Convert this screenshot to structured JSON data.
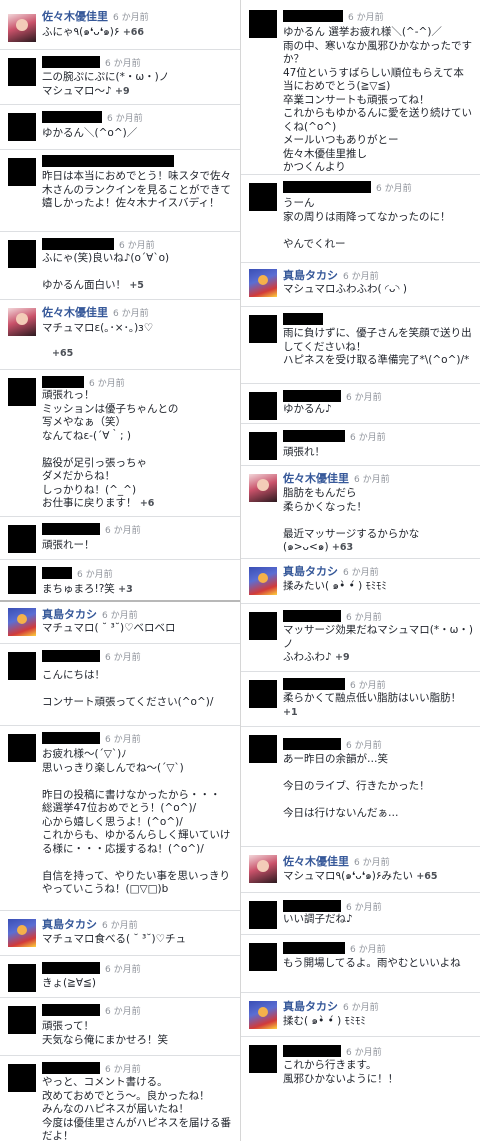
{
  "timestamp": "6 か月前",
  "left": [
    {
      "name": "佐々木優佳里",
      "text": "ふにゃ٩(๑❛ᴗ❛๑)۶",
      "likes": "+66"
    },
    {
      "name": "",
      "text": "二の腕ぷにぷに(*・ω・)ノ\nマシュマロ～♪",
      "likes": "+9"
    },
    {
      "name": "",
      "text": "ゆかるん＼(^o^)／",
      "likes": ""
    },
    {
      "name": "",
      "text": "昨日は本当におめでとう！味スタで佐々木さんのランクインを見ることができて嬉しかったよ！佐々木ナイスバディ！",
      "likes": ""
    },
    {
      "name": "",
      "text": "ふにゃ(笑)良いね♪(o´∀`o)\n\nゆかるん面白い！",
      "likes": "+5"
    },
    {
      "name": "佐々木優佳里",
      "text": "マチュマロε(｡･×･｡)з♡",
      "likes": "+65"
    },
    {
      "name": "",
      "text": "頑張れっ！\nミッションは優子ちゃんとの\n写メやなぁ（笑）\nなんてねε-(´∀｀; )\n\n脇役が足引っ張っちゃ\nダメだからね！\nしっかりね！(^_^)\nお仕事に戻ります！",
      "likes": "+6"
    },
    {
      "name": "",
      "text": "頑張れー！",
      "likes": ""
    },
    {
      "name": "",
      "text": "まちゅまろ!?笑",
      "likes": "+3"
    },
    {
      "name": "真島タカシ",
      "text": "マチュマロ( ˘ ³˘)♡ベロベロ",
      "likes": ""
    },
    {
      "name": "",
      "text": "こんにちは！\n\nコンサート頑張ってください(^o^)/",
      "likes": ""
    },
    {
      "name": "",
      "text": "お疲れ様〜(´▽`)ﾉ\n思いっきり楽しんでね〜(´▽`)\n\n昨日の投稿に書けなかったから・・・\n総選挙47位おめでとう！(^o^)/\n心から嬉しく思うよ！(^o^)/\nこれからも、ゆかるんらしく輝いていける様に・・・応援するね！(^o^)/\n\n自信を持って、やりたい事を思いっきりやっていこうね！(□▽□)b",
      "likes": ""
    },
    {
      "name": "真島タカシ",
      "text": "マチュマロ食べる( ˘ ³˘)♡チュ",
      "likes": ""
    },
    {
      "name": "",
      "text": "きょ(≧∀≦)",
      "likes": ""
    },
    {
      "name": "",
      "text": "頑張って！\n天気なら俺にまかせろ！笑",
      "likes": ""
    },
    {
      "name": "",
      "text": "やっと、コメント書ける。\n改めておめでとう〜。良かったね！\nみんなのハピネスが届いたね！\n今度は優佳里さんがハピネスを届ける番だよ！",
      "likes": ""
    }
  ],
  "right": [
    {
      "name": "",
      "text": "ゆかるん 選挙お疲れ様＼(^-^)／\n雨の中、寒いなか風邪ひかなかったですか？\n47位というすばらしい順位もらえて本当におめでとう(≧▽≦)\n卒業コンサートも頑張ってね！\nこれからもゆかるんに愛を送り続けていくね(^o^)\nメールいつもありがとー\n佐々木優佳里推し\nかつくんより",
      "likes": ""
    },
    {
      "name": "",
      "text": "うーん\n家の周りは雨降ってなかったのに！\n\nやんでくれー",
      "likes": ""
    },
    {
      "name": "真島タカシ",
      "text": "マシュマロふわふわ( ◜ᴗ◝ )",
      "likes": ""
    },
    {
      "name": "",
      "text": "雨に負けずに、優子さんを笑顔で送り出してくださいね！\nハピネスを受け取る準備完了*\\(^o^)/*",
      "likes": ""
    },
    {
      "name": "",
      "text": "ゆかるん♪",
      "likes": ""
    },
    {
      "name": "",
      "text": "頑張れ！",
      "likes": ""
    },
    {
      "name": "佐々木優佳里",
      "text": "脂肪をもんだら\n柔らかくなった！\n\n最近マッサージするからかな\n(๑>ᴗ<๑)",
      "likes": "+63"
    },
    {
      "name": "真島タカシ",
      "text": "揉みたい( ๑•̀ •́ ) ﾓﾐﾓﾐ",
      "likes": ""
    },
    {
      "name": "",
      "text": "マッサージ効果だねマシュマロ(*・ω・)ノ\nふわふわ♪",
      "likes": "+9"
    },
    {
      "name": "",
      "text": "柔らかくて融点低い脂肪はいい脂肪！",
      "likes": "+1"
    },
    {
      "name": "",
      "text": "あー昨日の余韻が…笑\n\n今日のライブ、行きたかった！\n\n今日は行けないんだぁ…",
      "likes": ""
    },
    {
      "name": "佐々木優佳里",
      "text": "マシュマロ٩(๑❛ᴗ❛๑)۶みたい",
      "likes": "+65"
    },
    {
      "name": "",
      "text": "いい調子だね♪",
      "likes": ""
    },
    {
      "name": "",
      "text": "もう開場してるよ。雨やむといいよね",
      "likes": ""
    },
    {
      "name": "真島タカシ",
      "text": "揉む( ๑•̀ •́ ) ﾓﾐﾓﾐ",
      "likes": ""
    },
    {
      "name": "",
      "text": "これから行きます。\n風邪ひかないように！！",
      "likes": ""
    }
  ]
}
